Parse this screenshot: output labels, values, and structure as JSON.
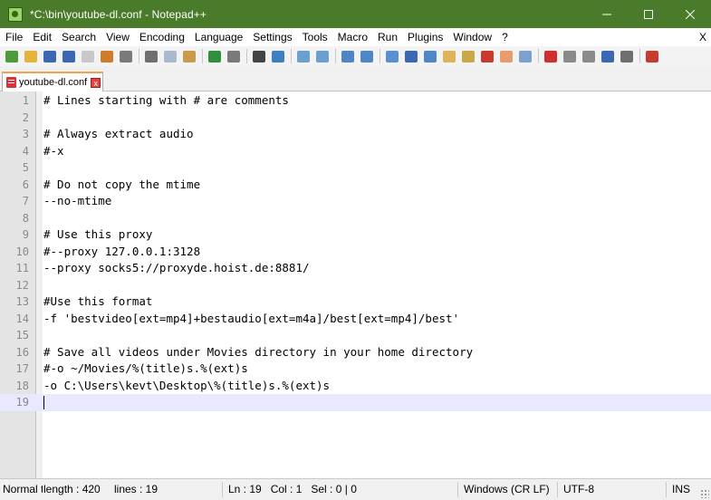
{
  "window": {
    "title": "*C:\\bin\\youtube-dl.conf - Notepad++",
    "minimize": "minimize",
    "maximize": "maximize",
    "close": "close"
  },
  "menu": {
    "items": [
      "File",
      "Edit",
      "Search",
      "View",
      "Encoding",
      "Language",
      "Settings",
      "Tools",
      "Macro",
      "Run",
      "Plugins",
      "Window",
      "?"
    ],
    "close_label": "X"
  },
  "toolbar": {
    "buttons": [
      {
        "icon": "new-file-icon",
        "color": "#4d9a3b"
      },
      {
        "icon": "open-file-icon",
        "color": "#e5b23c"
      },
      {
        "icon": "save-icon",
        "color": "#3b68b0"
      },
      {
        "icon": "save-all-icon",
        "color": "#3b68b0"
      },
      {
        "icon": "close-file-icon",
        "color": "#c8c8c8"
      },
      {
        "icon": "close-all-icon",
        "color": "#d07a2a"
      },
      {
        "icon": "print-icon",
        "color": "#7a7a7a"
      },
      {
        "sep": true
      },
      {
        "icon": "cut-icon",
        "color": "#6f6f6f"
      },
      {
        "icon": "copy-icon",
        "color": "#a9b9cf"
      },
      {
        "icon": "paste-icon",
        "color": "#c99b4b"
      },
      {
        "sep": true
      },
      {
        "icon": "undo-icon",
        "color": "#2f8f3d"
      },
      {
        "icon": "redo-icon",
        "color": "#7a7a7a"
      },
      {
        "sep": true
      },
      {
        "icon": "find-icon",
        "color": "#444444"
      },
      {
        "icon": "replace-icon",
        "color": "#3d7fc2"
      },
      {
        "sep": true
      },
      {
        "icon": "zoom-in-icon",
        "color": "#6a9fd0"
      },
      {
        "icon": "zoom-out-icon",
        "color": "#6a9fd0"
      },
      {
        "sep": true
      },
      {
        "icon": "sync-vertical-icon",
        "color": "#4f86c6"
      },
      {
        "icon": "sync-horizontal-icon",
        "color": "#4f86c6"
      },
      {
        "sep": true
      },
      {
        "icon": "word-wrap-icon",
        "color": "#5b8fd0"
      },
      {
        "icon": "show-all-chars-icon",
        "color": "#3b68b0"
      },
      {
        "icon": "indent-guide-icon",
        "color": "#4f86c6"
      },
      {
        "icon": "user-language-icon",
        "color": "#e0b35a"
      },
      {
        "icon": "document-map-icon",
        "color": "#c8a94a"
      },
      {
        "icon": "function-list-icon",
        "color": "#c83a2e"
      },
      {
        "icon": "folder-workspace-icon",
        "color": "#e89b6b"
      },
      {
        "icon": "monitoring-icon",
        "color": "#7ca0cf"
      },
      {
        "sep": true
      },
      {
        "icon": "record-macro-icon",
        "color": "#d03030"
      },
      {
        "icon": "stop-record-icon",
        "color": "#8a8a8a"
      },
      {
        "icon": "playback-icon",
        "color": "#8a8a8a"
      },
      {
        "icon": "run-macro-multiple-icon",
        "color": "#3b68b0"
      },
      {
        "icon": "save-macro-icon",
        "color": "#6f6f6f"
      },
      {
        "sep": true
      },
      {
        "icon": "spell-check-icon",
        "color": "#c83a2e"
      }
    ]
  },
  "tab": {
    "label": "youtube-dl.conf",
    "close": "x"
  },
  "editor": {
    "current_line": 19,
    "lines": [
      "# Lines starting with # are comments",
      "",
      "# Always extract audio",
      "#-x",
      "",
      "# Do not copy the mtime",
      "--no-mtime",
      "",
      "# Use this proxy",
      "#--proxy 127.0.0.1:3128",
      "--proxy socks5://proxyde.hoist.de:8881/",
      "",
      "#Use this format",
      "-f 'bestvideo[ext=mp4]+bestaudio[ext=m4a]/best[ext=mp4]/best'",
      "",
      "# Save all videos under Movies directory in your home directory",
      "#-o ~/Movies/%(title)s.%(ext)s",
      "-o C:\\Users\\kevt\\Desktop\\%(title)s.%(ext)s",
      ""
    ]
  },
  "status": {
    "doc_type": "Normal text file",
    "length": "length : 420",
    "lines": "lines : 19",
    "position": "Ln : 19   Col : 1   Sel : 0 | 0",
    "eol": "Windows (CR LF)",
    "encoding": "UTF-8",
    "mode": "INS"
  }
}
